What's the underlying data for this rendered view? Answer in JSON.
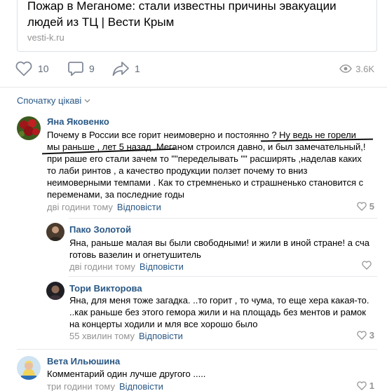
{
  "link_card": {
    "title": "Пожар в Меганоме: стали известны причины эвакуации людей из ТЦ | Вести Крым",
    "domain": "vesti-k.ru"
  },
  "actions": {
    "likes": "10",
    "comments": "9",
    "shares": "1",
    "views": "3.6K"
  },
  "sort": {
    "label": "Спочатку цікаві"
  },
  "comments": [
    {
      "author": "Яна Яковенко",
      "text_lines": [
        "Почему в России все горит неимоверно и постоянно ? Ну ведь не горели",
        "мы раньше , лет 5 назад .Меганом строился давно, и был замечательный,!",
        "при раше его стали зачем то \"\"переделывать \"\" расширять ,наделав каких",
        "то лаби ринтов , а качество продукции ползет почему то вниз",
        "неимоверными темпами . Как то стремненько и страшненько становится с",
        "переменами, за последние годы"
      ],
      "time": "дві години тому",
      "reply": "Відповісти",
      "likes": "5"
    },
    {
      "author": "Пако Золотой",
      "text_lines": [
        "Яна, раньше малая вы были свободными! и жили в иной стране! а сча",
        "готовь вазелин и огнетушитель"
      ],
      "time": "дві години тому",
      "reply": "Відповісти",
      "likes": ""
    },
    {
      "author": "Тори Викторова",
      "text_lines": [
        "Яна, для меня тоже загадка. ..то горит , то чума, то еще хера какая-то.",
        "..как раньше без этого гемора жили и на площадь без ментов и рамок",
        "на концерты ходили и мля все хорошо было"
      ],
      "time": "55 хвилин тому",
      "reply": "Відповісти",
      "likes": "3"
    },
    {
      "author": "Вета Ильюшина",
      "text_lines": [
        "Комментарий один лучше другого ....."
      ],
      "time": "три години тому",
      "reply": "Відповісти",
      "likes": "1"
    }
  ],
  "colors": {
    "link": "#2a5885",
    "muted": "#939393",
    "icon": "#828a99",
    "divider": "#e7e8ec"
  }
}
